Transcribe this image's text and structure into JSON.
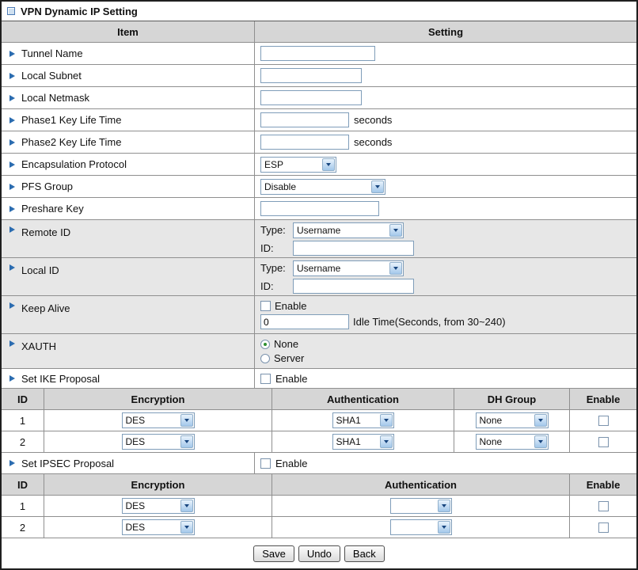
{
  "window": {
    "title": "VPN Dynamic IP Setting"
  },
  "table_header": {
    "item": "Item",
    "setting": "Setting"
  },
  "fields": {
    "tunnel_name": {
      "label": "Tunnel Name",
      "value": ""
    },
    "local_subnet": {
      "label": "Local Subnet",
      "value": ""
    },
    "local_netmask": {
      "label": "Local Netmask",
      "value": ""
    },
    "phase1_key_life_time": {
      "label": "Phase1 Key Life Time",
      "value": "",
      "suffix": "seconds"
    },
    "phase2_key_life_time": {
      "label": "Phase2 Key Life Time",
      "value": "",
      "suffix": "seconds"
    },
    "encapsulation_protocol": {
      "label": "Encapsulation Protocol",
      "selected": "ESP"
    },
    "pfs_group": {
      "label": "PFS Group",
      "selected": "Disable"
    },
    "preshare_key": {
      "label": "Preshare Key",
      "value": ""
    },
    "remote_id": {
      "label": "Remote ID",
      "type_label": "Type:",
      "type_selected": "Username",
      "id_label": "ID:",
      "id_value": ""
    },
    "local_id": {
      "label": "Local ID",
      "type_label": "Type:",
      "type_selected": "Username",
      "id_label": "ID:",
      "id_value": ""
    },
    "keep_alive": {
      "label": "Keep Alive",
      "enable_label": "Enable",
      "enabled": false,
      "idle_value": "0",
      "idle_suffix": "Idle Time(Seconds, from 30~240)"
    },
    "xauth": {
      "label": "XAUTH",
      "options": [
        {
          "label": "None",
          "selected": true
        },
        {
          "label": "Server",
          "selected": false
        }
      ]
    },
    "set_ike_proposal": {
      "label": "Set IKE Proposal",
      "enable_label": "Enable",
      "enabled": false
    },
    "set_ipsec_proposal": {
      "label": "Set IPSEC Proposal",
      "enable_label": "Enable",
      "enabled": false
    }
  },
  "ike_proposal_table": {
    "headers": {
      "id": "ID",
      "encryption": "Encryption",
      "authentication": "Authentication",
      "dh_group": "DH Group",
      "enable": "Enable"
    },
    "rows": [
      {
        "id": "1",
        "encryption": "DES",
        "authentication": "SHA1",
        "dh_group": "None",
        "enabled": false
      },
      {
        "id": "2",
        "encryption": "DES",
        "authentication": "SHA1",
        "dh_group": "None",
        "enabled": false
      }
    ]
  },
  "ipsec_proposal_table": {
    "headers": {
      "id": "ID",
      "encryption": "Encryption",
      "authentication": "Authentication",
      "enable": "Enable"
    },
    "rows": [
      {
        "id": "1",
        "encryption": "DES",
        "authentication": "",
        "enabled": false
      },
      {
        "id": "2",
        "encryption": "DES",
        "authentication": "",
        "enabled": false
      }
    ]
  },
  "buttons": {
    "save": "Save",
    "undo": "Undo",
    "back": "Back"
  },
  "icons": {
    "window": "square-outline-icon",
    "bullet": "right-arrow-icon",
    "dropdown": "down-arrow-icon"
  },
  "colors": {
    "header_bg": "#d6d6d6",
    "shaded_row_bg": "#e7e7e7",
    "grid_border": "#8f8f8f",
    "bullet_arrow": "#2b6cb0",
    "input_border": "#7f9db9",
    "radio_dot": "#2e8f2e"
  }
}
